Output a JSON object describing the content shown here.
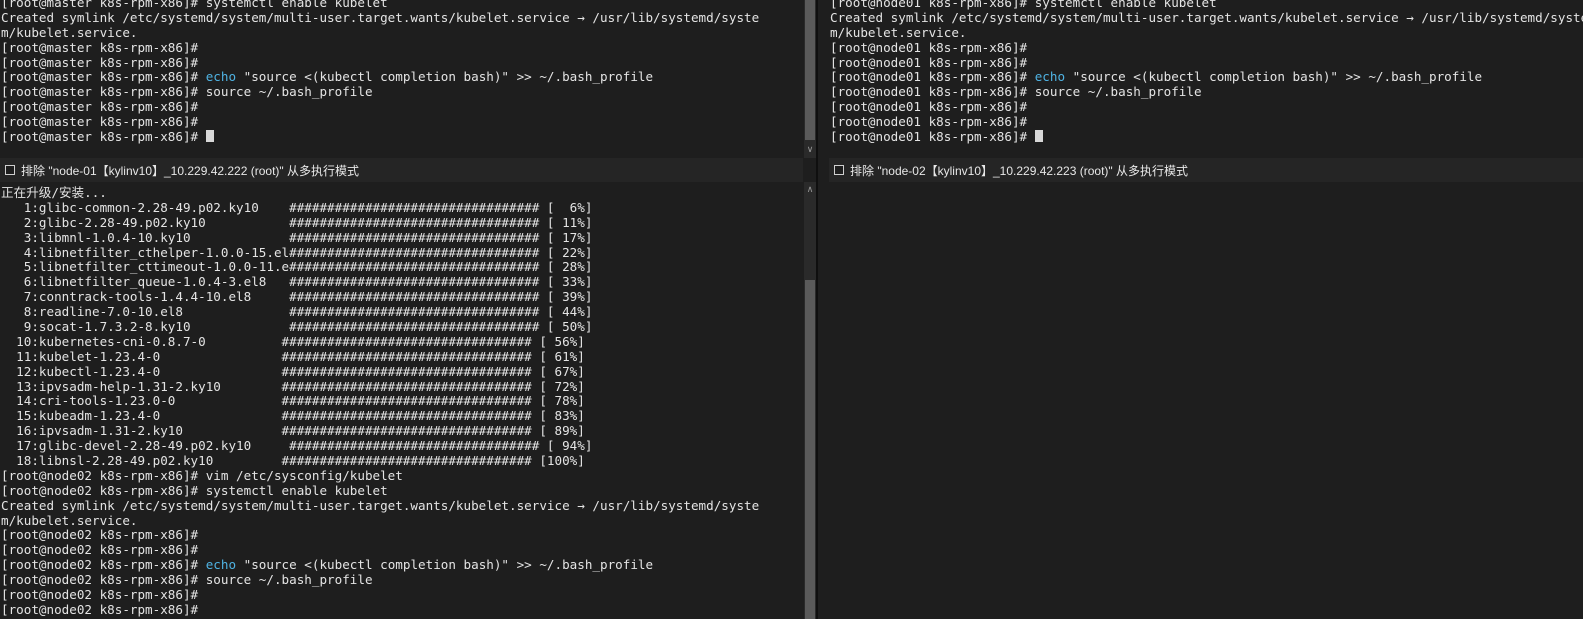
{
  "top_left": {
    "lines": [
      {
        "text": "[root@master k8s-rpm-x86]# systemctl enable kubelet"
      },
      {
        "text": "Created symlink /etc/systemd/system/multi-user.target.wants/kubelet.service → /usr/lib/systemd/syste"
      },
      {
        "text": "m/kubelet.service."
      },
      {
        "text": "[root@master k8s-rpm-x86]#"
      },
      {
        "text": "[root@master k8s-rpm-x86]#"
      },
      {
        "text": "[root@master k8s-rpm-x86]# ",
        "kw": "echo",
        "rest": " \"source <(kubectl completion bash)\" >> ~/.bash_profile"
      },
      {
        "text": "[root@master k8s-rpm-x86]# source ~/.bash_profile"
      },
      {
        "text": "[root@master k8s-rpm-x86]#"
      },
      {
        "text": "[root@master k8s-rpm-x86]#"
      },
      {
        "text": "[root@master k8s-rpm-x86]# ",
        "cursor": true
      }
    ]
  },
  "top_right": {
    "lines": [
      {
        "text": "[root@node01 k8s-rpm-x86]# systemctl enable kubelet"
      },
      {
        "text": "Created symlink /etc/systemd/system/multi-user.target.wants/kubelet.service → /usr/lib/systemd/system"
      },
      {
        "text": "m/kubelet.service."
      },
      {
        "text": "[root@node01 k8s-rpm-x86]#"
      },
      {
        "text": "[root@node01 k8s-rpm-x86]#"
      },
      {
        "text": "[root@node01 k8s-rpm-x86]# ",
        "kw": "echo",
        "rest": " \"source <(kubectl completion bash)\" >> ~/.bash_profile"
      },
      {
        "text": "[root@node01 k8s-rpm-x86]# source ~/.bash_profile"
      },
      {
        "text": "[root@node01 k8s-rpm-x86]#"
      },
      {
        "text": "[root@node01 k8s-rpm-x86]#"
      },
      {
        "text": "[root@node01 k8s-rpm-x86]# ",
        "cursor": true
      }
    ]
  },
  "bar_left": {
    "label": "排除 \"node-01【kylinv10】_10.229.42.222 (root)\" 从多执行模式"
  },
  "bar_right": {
    "label": "排除 \"node-02【kylinv10】_10.229.42.223 (root)\" 从多执行模式"
  },
  "bottom_left": {
    "lines": [
      {
        "text": "正在升级/安装..."
      },
      {
        "text": "   1:glibc-common-2.28-49.p02.ky10    ################################# [  6%]"
      },
      {
        "text": "   2:glibc-2.28-49.p02.ky10           ################################# [ 11%]"
      },
      {
        "text": "   3:libmnl-1.0.4-10.ky10             ################################# [ 17%]"
      },
      {
        "text": "   4:libnetfilter_cthelper-1.0.0-15.el################################# [ 22%]"
      },
      {
        "text": "   5:libnetfilter_cttimeout-1.0.0-11.e################################# [ 28%]"
      },
      {
        "text": "   6:libnetfilter_queue-1.0.4-3.el8   ################################# [ 33%]"
      },
      {
        "text": "   7:conntrack-tools-1.4.4-10.el8     ################################# [ 39%]"
      },
      {
        "text": "   8:readline-7.0-10.el8              ################################# [ 44%]"
      },
      {
        "text": "   9:socat-1.7.3.2-8.ky10             ################################# [ 50%]"
      },
      {
        "text": "  10:kubernetes-cni-0.8.7-0          ################################# [ 56%]"
      },
      {
        "text": "  11:kubelet-1.23.4-0                ################################# [ 61%]"
      },
      {
        "text": "  12:kubectl-1.23.4-0                ################################# [ 67%]"
      },
      {
        "text": "  13:ipvsadm-help-1.31-2.ky10        ################################# [ 72%]"
      },
      {
        "text": "  14:cri-tools-1.23.0-0              ################################# [ 78%]"
      },
      {
        "text": "  15:kubeadm-1.23.4-0                ################################# [ 83%]"
      },
      {
        "text": "  16:ipvsadm-1.31-2.ky10             ################################# [ 89%]"
      },
      {
        "text": "  17:glibc-devel-2.28-49.p02.ky10     ################################# [ 94%]"
      },
      {
        "text": "  18:libnsl-2.28-49.p02.ky10         ################################# [100%]"
      },
      {
        "text": "[root@node02 k8s-rpm-x86]# vim /etc/sysconfig/kubelet"
      },
      {
        "text": "[root@node02 k8s-rpm-x86]# systemctl enable kubelet"
      },
      {
        "text": "Created symlink /etc/systemd/system/multi-user.target.wants/kubelet.service → /usr/lib/systemd/syste"
      },
      {
        "text": "m/kubelet.service."
      },
      {
        "text": "[root@node02 k8s-rpm-x86]#"
      },
      {
        "text": "[root@node02 k8s-rpm-x86]#"
      },
      {
        "text": "[root@node02 k8s-rpm-x86]# ",
        "kw": "echo",
        "rest": " \"source <(kubectl completion bash)\" >> ~/.bash_profile"
      },
      {
        "text": "[root@node02 k8s-rpm-x86]# source ~/.bash_profile"
      },
      {
        "text": "[root@node02 k8s-rpm-x86]#"
      },
      {
        "text": "[root@node02 k8s-rpm-x86]#"
      }
    ]
  },
  "icons": {
    "scroll_up": "chevron-up-icon",
    "scroll_down": "chevron-down-icon",
    "checkbox": "checkbox-icon"
  },
  "colors": {
    "background": "#1e1e1e",
    "text": "#e4e4e4",
    "keyword": "#4fb3e3",
    "bar": "#252525"
  }
}
